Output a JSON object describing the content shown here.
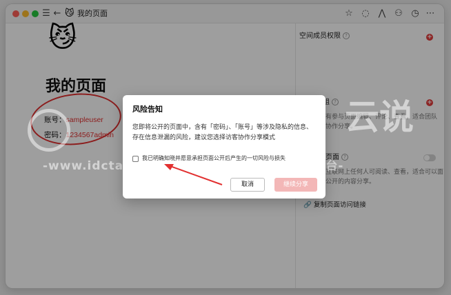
{
  "window": {
    "doc_title": "我的页面",
    "doc_emoji": "😼"
  },
  "toolbar_icons": [
    "menu-icon",
    "back-icon",
    "forward-icon",
    "star-icon",
    "comment-icon",
    "network-icon",
    "share-user-icon",
    "history-icon",
    "more-icon"
  ],
  "page": {
    "emoji": "😼",
    "title": "我的页面",
    "account_label": "账号：",
    "account_value": "sampleuser",
    "password_label": "密码：",
    "password_value": "1234567admin"
  },
  "sidebar": {
    "members_heading": "空间成员权限",
    "section2_heading": "组",
    "section2_desc_line1": "有参与页面编辑、评论、查看，适合团队",
    "section2_desc_line2": "协作分享。",
    "section3_heading": "页面",
    "section3_desc_line1": "互联网上任何人可阅读、查看，适合可以面",
    "section3_desc_line2": "公开的内容分享。",
    "copy_link": "复制页面访问链接"
  },
  "watermark": {
    "logo_text": "TALK",
    "logo_cn": "云说",
    "url_line": "-www.idctalk.com-国内专业云计算交流服务平台-"
  },
  "modal": {
    "title": "风险告知",
    "body": "您即将公开的页面中，含有「密码」、「账号」等涉及隐私的信息、存在信息泄漏的风险，建议您选择访客协作分享模式",
    "checkbox_label": "我已明确知晓并愿意承担页面公开后产生的一切风险与损失",
    "cancel_label": "取消",
    "confirm_label": "继续分享"
  },
  "colors": {
    "accent": "#e23030",
    "confirm_disabled": "#f3b7b7"
  }
}
